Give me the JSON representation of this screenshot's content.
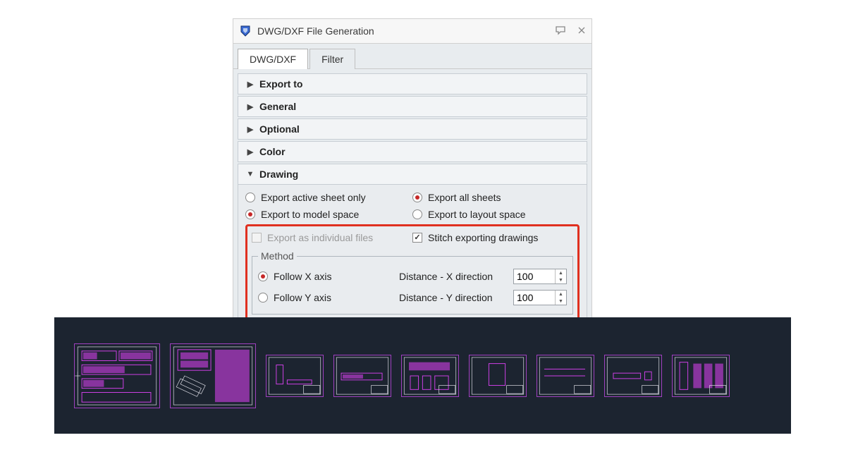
{
  "dialog": {
    "title": "DWG/DXF File Generation",
    "tabs": [
      {
        "label": "DWG/DXF",
        "active": true
      },
      {
        "label": "Filter",
        "active": false
      }
    ],
    "sections": {
      "export_to": {
        "label": "Export to"
      },
      "general": {
        "label": "General"
      },
      "optional": {
        "label": "Optional"
      },
      "color": {
        "label": "Color"
      },
      "drawing": {
        "label": "Drawing"
      }
    },
    "drawing": {
      "export_active_sheet": "Export active sheet only",
      "export_all_sheets": "Export all sheets",
      "export_model_space": "Export to model space",
      "export_layout_space": "Export to layout space",
      "export_individual": "Export as individual files",
      "stitch_exporting": "Stitch exporting drawings",
      "method_legend": "Method",
      "follow_x": "Follow X axis",
      "follow_y": "Follow Y axis",
      "dist_x_label": "Distance - X direction",
      "dist_y_label": "Distance - Y direction",
      "dist_x_value": "100",
      "dist_y_value": "100"
    }
  }
}
